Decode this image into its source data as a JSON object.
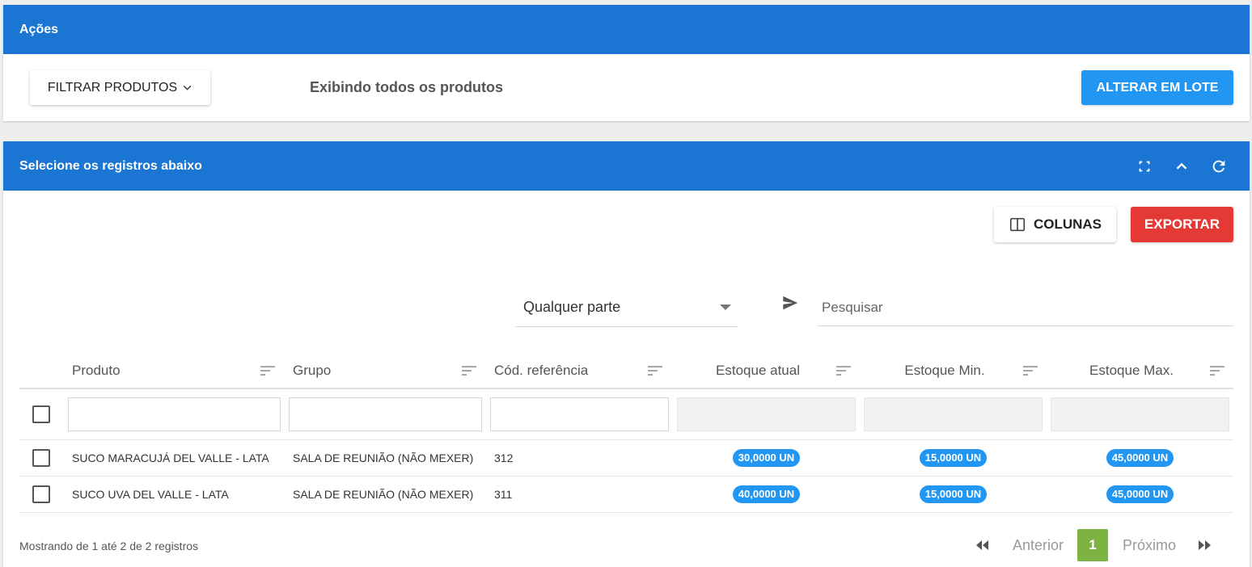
{
  "actions_card": {
    "title": "Ações",
    "filter_button": "FILTRAR PRODUTOS",
    "status_text": "Exibindo todos os produtos",
    "batch_button": "ALTERAR EM LOTE"
  },
  "records_card": {
    "title": "Selecione os registros abaixo",
    "header_icons": [
      "fullscreen-icon",
      "chevron-up-icon",
      "refresh-icon"
    ],
    "columns_button": "COLUNAS",
    "export_button": "EXPORTAR",
    "search_mode": "Qualquer parte",
    "search_placeholder": "Pesquisar",
    "columns": [
      "Produto",
      "Grupo",
      "Cód. referência",
      "Estoque atual",
      "Estoque Min.",
      "Estoque Max."
    ],
    "rows": [
      {
        "produto": "SUCO MARACUJÁ DEL VALLE - LATA",
        "grupo": "SALA DE REUNIÃO (NÃO MEXER)",
        "codigo": "312",
        "estoque_atual": "30,0000 UN",
        "estoque_min": "15,0000 UN",
        "estoque_max": "45,0000 UN"
      },
      {
        "produto": "SUCO UVA DEL VALLE - LATA",
        "grupo": "SALA DE REUNIÃO (NÃO MEXER)",
        "codigo": "311",
        "estoque_atual": "40,0000 UN",
        "estoque_min": "15,0000 UN",
        "estoque_max": "45,0000 UN"
      }
    ],
    "footer_info": "Mostrando de 1 até 2 de 2 registros",
    "pagination": {
      "previous": "Anterior",
      "current": "1",
      "next": "Próximo"
    }
  },
  "colors": {
    "header_blue": "#1a76d2",
    "primary_button": "#2196f3",
    "export_red": "#e53935",
    "current_page_green": "#7cb342"
  }
}
